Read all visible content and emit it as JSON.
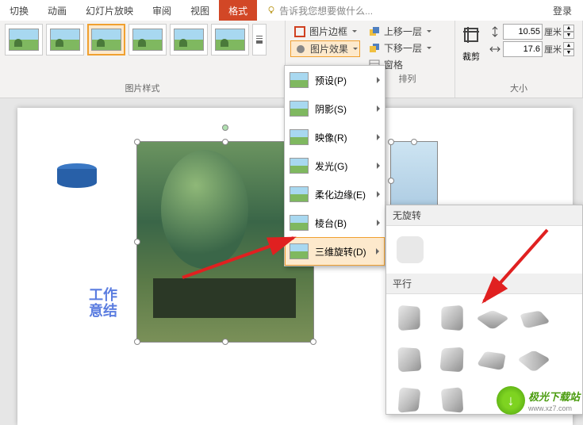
{
  "tabs": {
    "switch": "切换",
    "anim": "动画",
    "slideshow": "幻灯片放映",
    "review": "审阅",
    "view": "视图",
    "format": "格式",
    "hint": "告诉我您想要做什么...",
    "login": "登录"
  },
  "ribbon": {
    "picBorder": "图片边框",
    "picEffects": "图片效果",
    "bringForward": "上移一层",
    "sendBackward": "下移一层",
    "selectionPane": "窗格",
    "crop": "裁剪",
    "stylesLabel": "图片样式",
    "arrangeLabel": "排列",
    "sizeLabel": "大小",
    "height": "10.55",
    "width": "17.6",
    "unit": "厘米"
  },
  "menu": {
    "preset": "预设(P)",
    "shadow": "阴影(S)",
    "reflection": "映像(R)",
    "glow": "发光(G)",
    "softEdges": "柔化边缘(E)",
    "bevel": "棱台(B)",
    "rotation3d": "三维旋转(D)"
  },
  "panel": {
    "noRotation": "无旋转",
    "parallel": "平行"
  },
  "watermark": {
    "line1": "工作",
    "line2": "意结"
  },
  "logo": {
    "name": "极光下载站",
    "url": "www.xz7.com"
  }
}
